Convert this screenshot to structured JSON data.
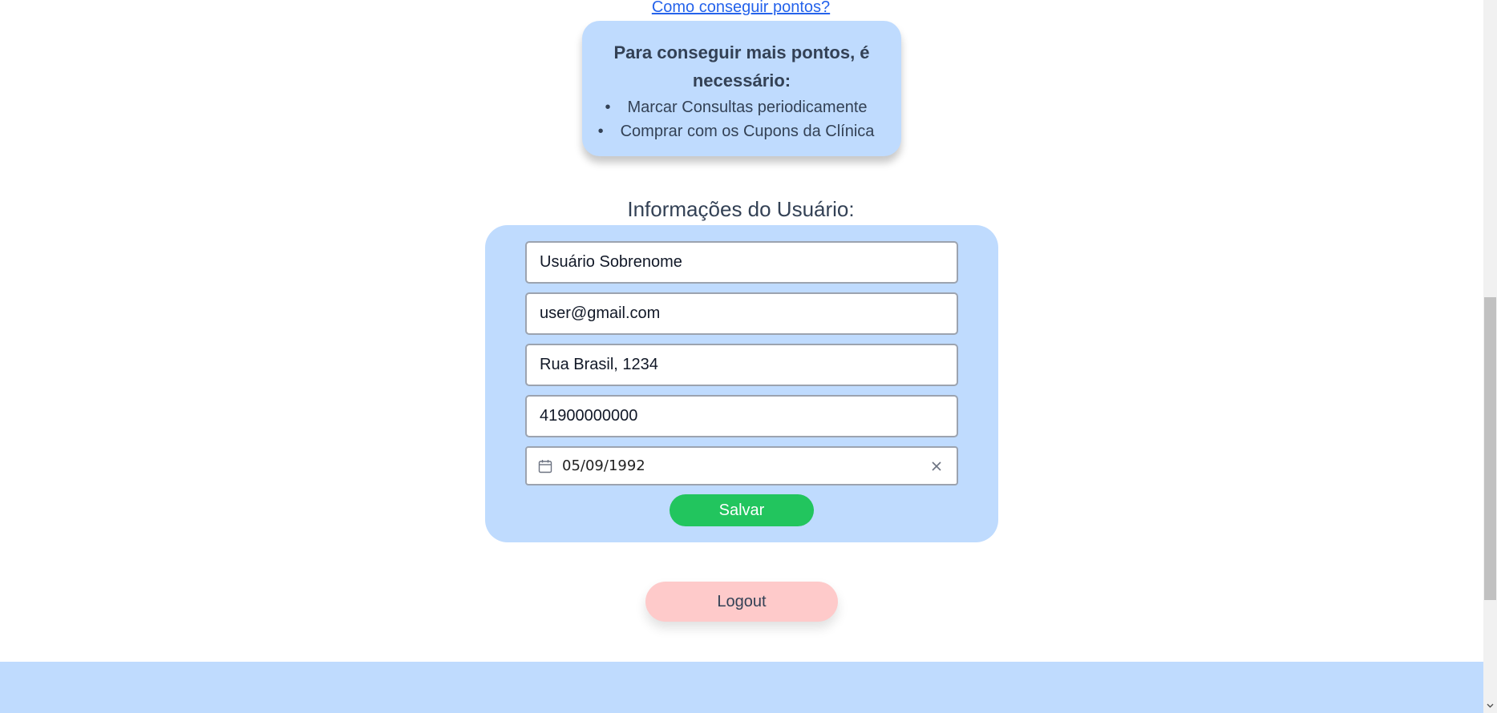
{
  "points_link": "Como conseguir pontos?",
  "points_info": {
    "heading": "Para conseguir mais pontos, é necessário:",
    "items": [
      "Marcar Consultas periodicamente",
      "Comprar com os Cupons da Clínica"
    ]
  },
  "user_section": {
    "title": "Informações do Usuário:",
    "name": "Usuário Sobrenome",
    "email": "user@gmail.com",
    "address": "Rua Brasil, 1234",
    "phone": "41900000000",
    "birthdate": "05/09/1992",
    "save_label": "Salvar"
  },
  "logout_label": "Logout",
  "icons": {
    "date": "calendar-icon",
    "clear": "close-icon"
  },
  "colors": {
    "card_bg": "#bfdbfe",
    "save": "#22c55e",
    "logout": "#fecaca",
    "link": "#2563eb"
  }
}
